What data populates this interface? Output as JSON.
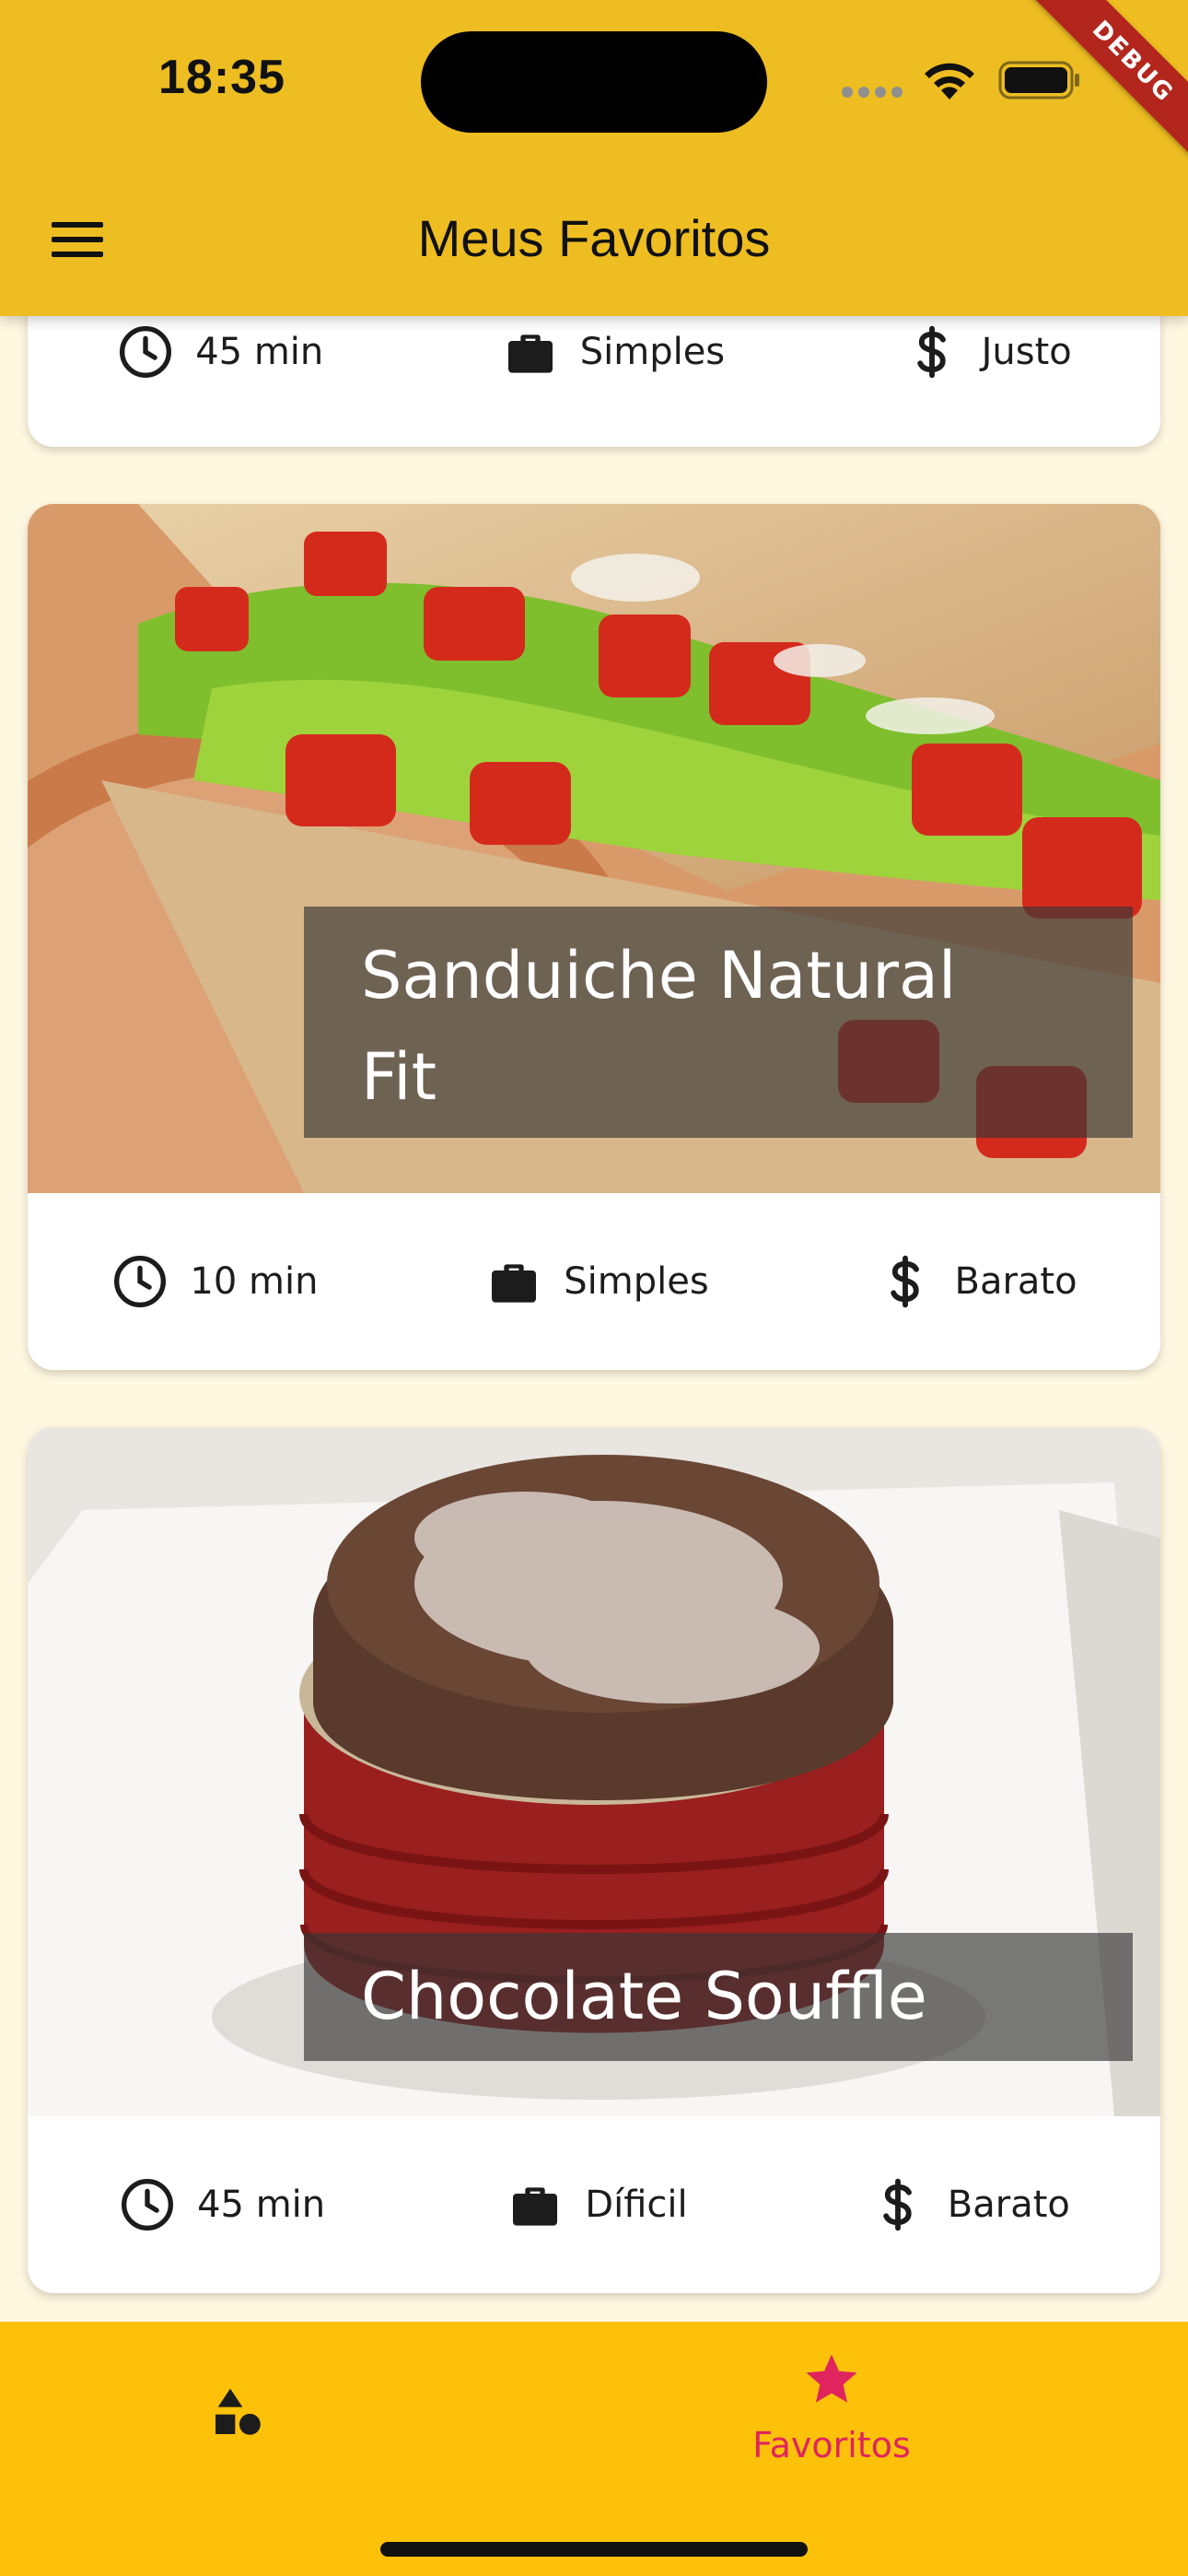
{
  "status_bar": {
    "time": "18:35",
    "debug_label": "DEBUG"
  },
  "appbar": {
    "title": "Meus Favoritos",
    "menu_icon": "hamburger-menu-icon"
  },
  "meals": [
    {
      "title": "",
      "duration": "45 min",
      "complexity": "Simples",
      "cost": "Justo"
    },
    {
      "title": "Sanduiche Natural Fit",
      "title_line1": "Sanduiche Natural",
      "title_line2": "Fit",
      "duration": "10 min",
      "complexity": "Simples",
      "cost": "Barato"
    },
    {
      "title": "Chocolate Souffle",
      "duration": "45 min",
      "complexity": "Díficil",
      "cost": "Barato"
    }
  ],
  "bottom_nav": {
    "items": [
      {
        "icon": "categories-icon",
        "label": ""
      },
      {
        "icon": "star-icon",
        "label": "Favoritos",
        "active": true
      }
    ]
  },
  "colors": {
    "appbar": "#edbd22",
    "bottom_nav": "#fdc109",
    "background": "#fff8e1",
    "active_tab": "#e0245e",
    "title_overlay": "rgba(55,55,55,0.66)"
  }
}
